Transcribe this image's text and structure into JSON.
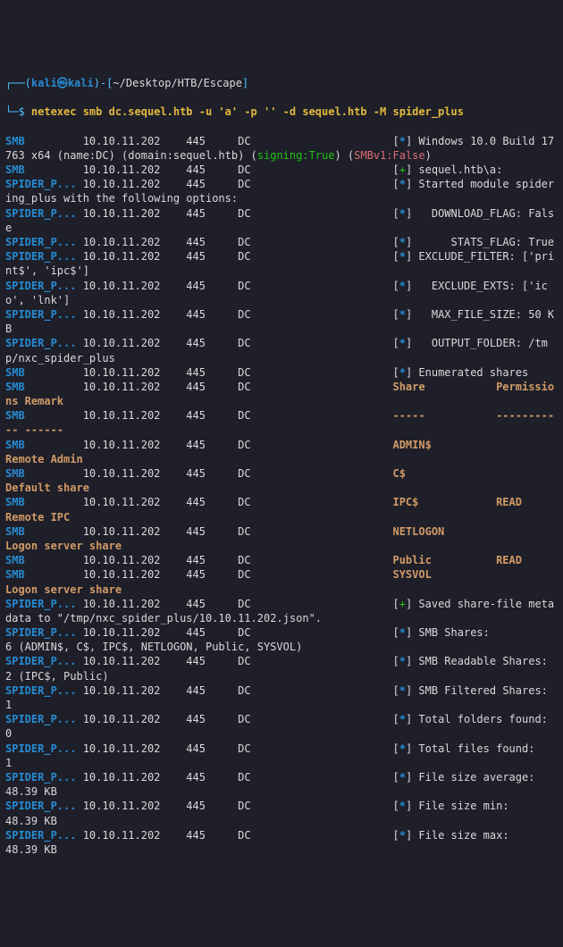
{
  "prompt": {
    "user": "kali",
    "host": "kali",
    "path": "~/Desktop/HTB/Escape",
    "sym_open": "┌──(",
    "sym_close": ")-[",
    "sym_end": "]",
    "sym_lead": "└─$ "
  },
  "command": "netexec smb dc.sequel.htb -u 'a' -p '' -d sequel.htb -M spider_plus",
  "rows": [
    {
      "proto": "SMB",
      "ip": "10.10.11.202",
      "port": "445",
      "host": "DC",
      "sym": "[*]",
      "msg": "Windows 10.0 Build 17763 x64 (name:DC) (domain:sequel.htb) (",
      "tail1": "signing:True",
      "tail2": ") (",
      "tail3": "SMBv1:False",
      "tail4": ")"
    },
    {
      "proto": "SMB",
      "ip": "10.10.11.202",
      "port": "445",
      "host": "DC",
      "sym": "[+]",
      "msg": "sequel.htb\\a:"
    },
    {
      "proto": "SPIDER_P...",
      "ip": "10.10.11.202",
      "port": "445",
      "host": "DC",
      "sym": "[*]",
      "msg": "Started module spidering_plus with the following options:"
    },
    {
      "proto": "SPIDER_P...",
      "ip": "10.10.11.202",
      "port": "445",
      "host": "DC",
      "sym": "[*]",
      "msg": "  DOWNLOAD_FLAG: False"
    },
    {
      "proto": "SPIDER_P...",
      "ip": "10.10.11.202",
      "port": "445",
      "host": "DC",
      "sym": "[*]",
      "msg": "     STATS_FLAG: True"
    },
    {
      "proto": "SPIDER_P...",
      "ip": "10.10.11.202",
      "port": "445",
      "host": "DC",
      "sym": "[*]",
      "msg": "EXCLUDE_FILTER: ['print$', 'ipc$']"
    },
    {
      "proto": "SPIDER_P...",
      "ip": "10.10.11.202",
      "port": "445",
      "host": "DC",
      "sym": "[*]",
      "msg": "  EXCLUDE_EXTS: ['ico', 'lnk']"
    },
    {
      "proto": "SPIDER_P...",
      "ip": "10.10.11.202",
      "port": "445",
      "host": "DC",
      "sym": "[*]",
      "msg": "  MAX_FILE_SIZE: 50 KB"
    },
    {
      "proto": "SPIDER_P...",
      "ip": "10.10.11.202",
      "port": "445",
      "host": "DC",
      "sym": "[*]",
      "msg": "  OUTPUT_FOLDER: /tmp/nxc_spider_plus"
    },
    {
      "proto": "SMB",
      "ip": "10.10.11.202",
      "port": "445",
      "host": "DC",
      "sym": "[*]",
      "msg": "Enumerated shares"
    },
    {
      "proto": "SMB",
      "ip": "10.10.11.202",
      "port": "445",
      "host": "DC",
      "sym": "",
      "share": "Share",
      "perm": "Permissions",
      "remark": "Remark",
      "header": true
    },
    {
      "proto": "SMB",
      "ip": "10.10.11.202",
      "port": "445",
      "host": "DC",
      "sym": "",
      "share": "-----",
      "perm": "-----------",
      "remark": "------",
      "header": true
    },
    {
      "proto": "SMB",
      "ip": "10.10.11.202",
      "port": "445",
      "host": "DC",
      "sym": "",
      "share": "ADMIN$",
      "perm": "",
      "remark": "Remote Admin"
    },
    {
      "proto": "SMB",
      "ip": "10.10.11.202",
      "port": "445",
      "host": "DC",
      "sym": "",
      "share": "C$",
      "perm": "",
      "remark": "Default share"
    },
    {
      "proto": "SMB",
      "ip": "10.10.11.202",
      "port": "445",
      "host": "DC",
      "sym": "",
      "share": "IPC$",
      "perm": "READ",
      "remark": "Remote IPC"
    },
    {
      "proto": "SMB",
      "ip": "10.10.11.202",
      "port": "445",
      "host": "DC",
      "sym": "",
      "share": "NETLOGON",
      "perm": "",
      "remark": "Logon server share"
    },
    {
      "proto": "SMB",
      "ip": "10.10.11.202",
      "port": "445",
      "host": "DC",
      "sym": "",
      "share": "Public",
      "perm": "READ",
      "remark": ""
    },
    {
      "proto": "SMB",
      "ip": "10.10.11.202",
      "port": "445",
      "host": "DC",
      "sym": "",
      "share": "SYSVOL",
      "perm": "",
      "remark": "Logon server share"
    },
    {
      "proto": "SPIDER_P...",
      "ip": "10.10.11.202",
      "port": "445",
      "host": "DC",
      "sym": "[+]",
      "msg": "Saved share-file metadata to \"/tmp/nxc_spider_plus/10.10.11.202.json\"."
    },
    {
      "proto": "SPIDER_P...",
      "ip": "10.10.11.202",
      "port": "445",
      "host": "DC",
      "sym": "[*]",
      "msg": "SMB Shares:           6 (ADMIN$, C$, IPC$, NETLOGON, Public, SYSVOL)"
    },
    {
      "proto": "SPIDER_P...",
      "ip": "10.10.11.202",
      "port": "445",
      "host": "DC",
      "sym": "[*]",
      "msg": "SMB Readable Shares:  2 (IPC$, Public)"
    },
    {
      "proto": "SPIDER_P...",
      "ip": "10.10.11.202",
      "port": "445",
      "host": "DC",
      "sym": "[*]",
      "msg": "SMB Filtered Shares:  1"
    },
    {
      "proto": "SPIDER_P...",
      "ip": "10.10.11.202",
      "port": "445",
      "host": "DC",
      "sym": "[*]",
      "msg": "Total folders found:  0"
    },
    {
      "proto": "SPIDER_P...",
      "ip": "10.10.11.202",
      "port": "445",
      "host": "DC",
      "sym": "[*]",
      "msg": "Total files found:    1"
    },
    {
      "proto": "SPIDER_P...",
      "ip": "10.10.11.202",
      "port": "445",
      "host": "DC",
      "sym": "[*]",
      "msg": "File size average:    48.39 KB"
    },
    {
      "proto": "SPIDER_P...",
      "ip": "10.10.11.202",
      "port": "445",
      "host": "DC",
      "sym": "[*]",
      "msg": "File size min:        48.39 KB"
    },
    {
      "proto": "SPIDER_P...",
      "ip": "10.10.11.202",
      "port": "445",
      "host": "DC",
      "sym": "[*]",
      "msg": "File size max:        48.39 KB"
    }
  ]
}
